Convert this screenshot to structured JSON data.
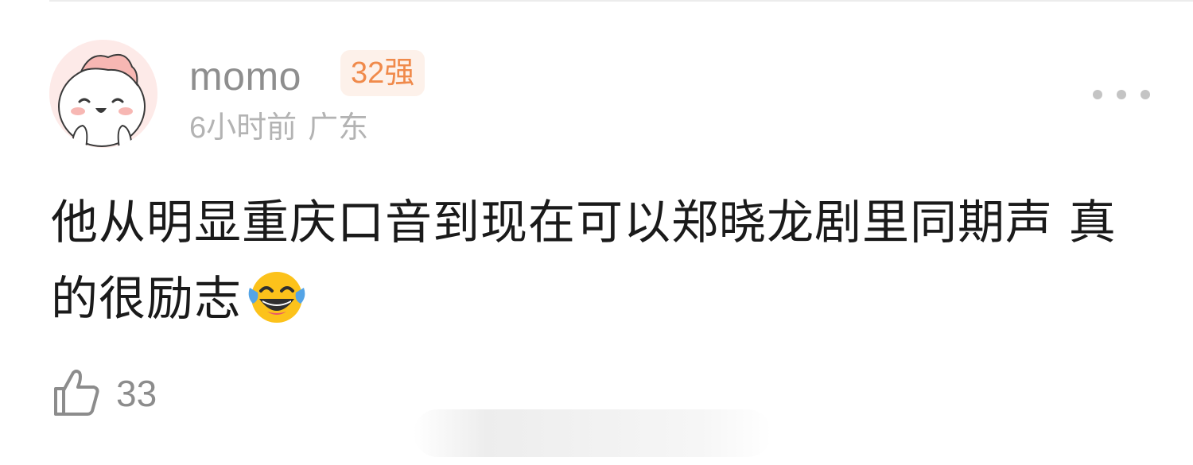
{
  "comment": {
    "username": "momo",
    "rank_badge": "32强",
    "time": "6小时前",
    "location": "广东",
    "text": "他从明显重庆口音到现在可以郑晓龙剧里同期声 真的很励志",
    "emoji": "laughing-with-tears-emoji",
    "like_count": "33"
  },
  "colors": {
    "username": "#8e8e8e",
    "badge_text": "#f08a4b",
    "badge_bg": "#fdf1ea",
    "meta": "#b3b3b3",
    "body_text": "#1a1a1a",
    "avatar_bg": "#fdebea"
  },
  "icons": {
    "more": "ellipsis-icon",
    "like": "thumbs-up-icon"
  }
}
